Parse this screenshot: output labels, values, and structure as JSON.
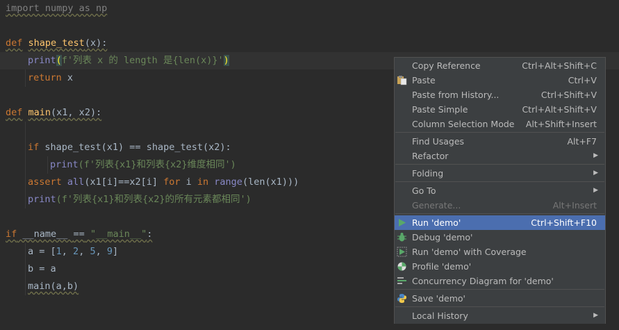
{
  "code": {
    "l1_import": "import numpy as np",
    "l3_def": "def",
    "l3_name": "shape_test",
    "l3_rest": "(x):",
    "l4_print": "print",
    "l4_str": "f'列表 x 的 length 是{len(x)}'",
    "l5_return": "return",
    "l5_rest": " x",
    "l7_def": "def",
    "l7_name": "main",
    "l7_rest": "(x1, x2):",
    "l9_if": "if",
    "l9_rest": " shape_test(x1) == shape_test(x2):",
    "l10_print": "print",
    "l10_str": "(f'列表{x1}和列表{x2}维度相同')",
    "l11_assert": "assert",
    "l11_all": "all",
    "l11_mid": "(x1[i]==x2[i] ",
    "l11_for": "for",
    "l11_i": " i ",
    "l11_in": "in",
    "l11_range": " range",
    "l11_end": "(len(x1)))",
    "l12_print": "print",
    "l12_str": "(f'列表{x1}和列表{x2}的所有元素都相同')",
    "l14_if": "if",
    "l14_name": " __name__ ",
    "l14_eq": "==",
    "l14_main": " \"__main__\"",
    "l14_colon": ":",
    "l15_a": "a = [",
    "l15_n1": "1",
    "l15_n2": "2",
    "l15_n3": "5",
    "l15_n4": "9",
    "l16_b": "b = a",
    "l17_main": "main(a,b)"
  },
  "menu": {
    "copy_reference": {
      "label": "Copy Reference",
      "shortcut": "Ctrl+Alt+Shift+C"
    },
    "paste": {
      "label": "Paste",
      "shortcut": "Ctrl+V"
    },
    "paste_history": {
      "label": "Paste from History...",
      "shortcut": "Ctrl+Shift+V"
    },
    "paste_simple": {
      "label": "Paste Simple",
      "shortcut": "Ctrl+Alt+Shift+V"
    },
    "column_selection": {
      "label": "Column Selection Mode",
      "shortcut": "Alt+Shift+Insert"
    },
    "find_usages": {
      "label": "Find Usages",
      "shortcut": "Alt+F7"
    },
    "refactor": {
      "label": "Refactor"
    },
    "folding": {
      "label": "Folding"
    },
    "go_to": {
      "label": "Go To"
    },
    "generate": {
      "label": "Generate...",
      "shortcut": "Alt+Insert"
    },
    "run": {
      "label": "Run 'demo'",
      "shortcut": "Ctrl+Shift+F10"
    },
    "debug": {
      "label": "Debug 'demo'"
    },
    "coverage": {
      "label": "Run 'demo' with Coverage"
    },
    "profile": {
      "label": "Profile 'demo'"
    },
    "concurrency": {
      "label": "Concurrency Diagram for  'demo'"
    },
    "save": {
      "label": "Save 'demo'"
    },
    "local_history": {
      "label": "Local History"
    }
  },
  "colors": {
    "background": "#2b2b2b",
    "menu_bg": "#3c3f41",
    "selection": "#4b6eaf",
    "keyword": "#cc7832",
    "string": "#6a8759",
    "function": "#ffc66d"
  }
}
